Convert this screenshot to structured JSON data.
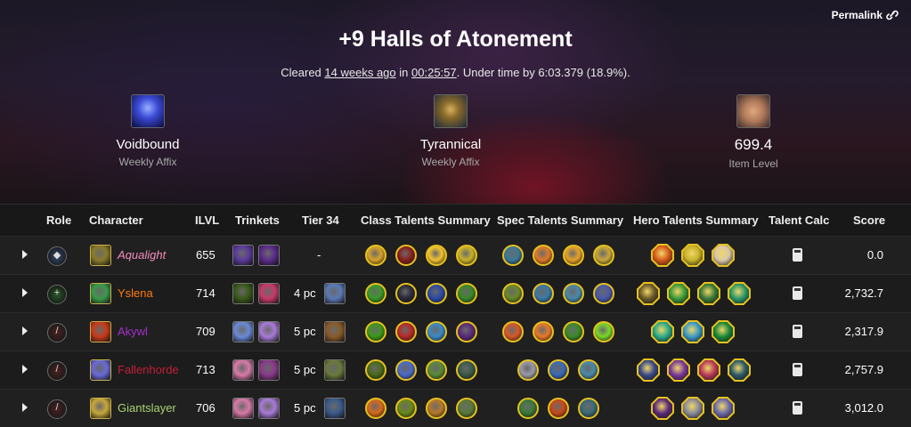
{
  "header": {
    "permalink_label": "Permalink",
    "title": "+9 Halls of Atonement",
    "sub_cleared": "Cleared",
    "sub_ago": "14 weeks ago",
    "sub_in": "in",
    "sub_time": "00:25:57",
    "sub_rest": ". Under time by 6:03.379 (18.9%)."
  },
  "affixes": [
    {
      "name": "Voidbound",
      "sub": "Weekly Affix",
      "icon": "voidbound-icon",
      "color": "#3b4bd6"
    },
    {
      "name": "Tyrannical",
      "sub": "Weekly Affix",
      "icon": "tyrannical-icon",
      "color": "#8a6a2a"
    },
    {
      "name": "699.4",
      "sub": "Item Level",
      "icon": "item-level-icon",
      "color": "#b07a5a"
    }
  ],
  "columns": [
    "Role",
    "Character",
    "ILVL",
    "Trinkets",
    "Tier 34",
    "Class Talents Summary",
    "Spec Talents Summary",
    "Hero Talents Summary",
    "Talent Calc",
    "Score"
  ],
  "rows": [
    {
      "role": "tank",
      "role_glyph": "◆",
      "name": "Aqualight",
      "name_color": "#f48cba",
      "italic": true,
      "ilvl": "655",
      "tier": "-",
      "score": "0.0",
      "class_colors": [
        "#d9a22a",
        "#8a1f1f",
        "#f2c22e",
        "#c9b22a"
      ],
      "spec_colors": [
        "#3a7a9a",
        "#e07a2a",
        "#e8a22a",
        "#c9a83a"
      ],
      "hero_colors": [
        "#d85a1a",
        "#c9b22a",
        "#d9c8a8"
      ],
      "trinket_colors": [
        "#5a3a9a",
        "#5a2a8a"
      ],
      "spec_icon_color": "#8a7a2a"
    },
    {
      "role": "heal",
      "role_glyph": "+",
      "name": "Yslena",
      "name_color": "#ff7c0a",
      "italic": false,
      "ilvl": "714",
      "tier": "4 pc",
      "score": "2,732.7",
      "class_colors": [
        "#3a9a2a",
        "#2a2a3a",
        "#2a4aa8",
        "#3a8a2a"
      ],
      "spec_colors": [
        "#6a8a2a",
        "#3a7aaa",
        "#4a8aaa",
        "#4a5aaa"
      ],
      "hero_colors": [
        "#6a5a2a",
        "#3a9a3a",
        "#3a7a3a",
        "#2a9a6a"
      ],
      "trinket_colors": [
        "#3a5a1a",
        "#c83a6a"
      ],
      "spec_icon_color": "#3a9a4a",
      "tier_color": "#5a7ab8"
    },
    {
      "role": "dps",
      "role_glyph": "/",
      "name": "Akywl",
      "name_color": "#a330c9",
      "italic": false,
      "ilvl": "709",
      "tier": "5 pc",
      "score": "2,317.9",
      "class_colors": [
        "#3a9a1a",
        "#b82a2a",
        "#3a8ac8",
        "#5a2a7a"
      ],
      "spec_colors": [
        "#d8582a",
        "#e8782a",
        "#3a8a2a",
        "#7ad82a"
      ],
      "hero_colors": [
        "#2aaa8a",
        "#3a9ac8",
        "#1a8a3a"
      ],
      "trinket_colors": [
        "#6a8ad8",
        "#a87ad8"
      ],
      "spec_icon_color": "#c83a1a",
      "tier_color": "#8a5a2a"
    },
    {
      "role": "dps",
      "role_glyph": "/",
      "name": "Fallenhorde",
      "name_color": "#c41e3a",
      "italic": false,
      "ilvl": "713",
      "tier": "5 pc",
      "score": "2,757.9",
      "class_colors": [
        "#4a6a1a",
        "#4a6ac8",
        "#5a8a3a",
        "#3a5a4a"
      ],
      "spec_colors": [
        "#9a9aaa",
        "#3a6ab8",
        "#4a8aaa"
      ],
      "hero_colors": [
        "#3a4a8a",
        "#7a3a9a",
        "#b83a5a",
        "#2a5a6a"
      ],
      "trinket_colors": [
        "#d87aa8",
        "#8a3a8a"
      ],
      "spec_icon_color": "#6a6ad8",
      "tier_color": "#6a7a3a"
    },
    {
      "role": "dps",
      "role_glyph": "/",
      "name": "Giantslayer",
      "name_color": "#aad372",
      "italic": false,
      "ilvl": "706",
      "tier": "5 pc",
      "score": "3,012.0",
      "class_colors": [
        "#d86a1a",
        "#6a8a1a",
        "#b87a2a",
        "#5a7a3a"
      ],
      "spec_colors": [
        "#3a7a3a",
        "#c84a1a",
        "#3a6a7a"
      ],
      "hero_colors": [
        "#5a2a7a",
        "#8a8a9a",
        "#6a6aaa"
      ],
      "trinket_colors": [
        "#d87aa8",
        "#a87ad8"
      ],
      "spec_icon_color": "#c8a83a",
      "tier_color": "#3a5a8a"
    }
  ]
}
